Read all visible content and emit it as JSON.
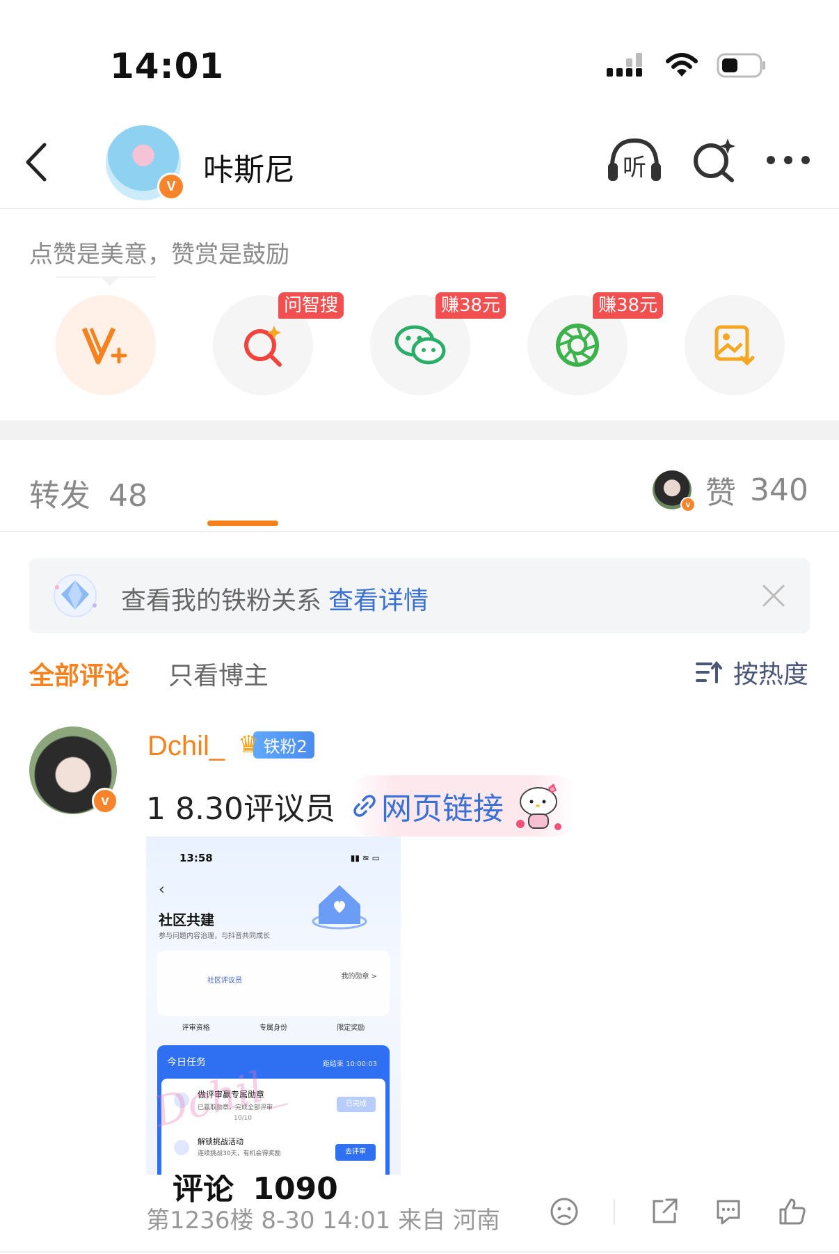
{
  "status_bar": {
    "time": "14:01"
  },
  "header": {
    "username": "咔斯尼",
    "verified_badge": "V"
  },
  "reward": {
    "tip": "点赞是美意，赞赏是鼓励",
    "actions": [
      {
        "icon": "v-plus-icon",
        "tag": ""
      },
      {
        "icon": "search-ai-icon",
        "tag": "问智搜"
      },
      {
        "icon": "wechat-icon",
        "tag": "赚38元"
      },
      {
        "icon": "moments-icon",
        "tag": "赚38元"
      },
      {
        "icon": "save-image-icon",
        "tag": ""
      }
    ]
  },
  "tabs": {
    "repost_label": "转发",
    "repost_count": "48",
    "comment_label": "评论",
    "comment_count": "1090",
    "like_label": "赞",
    "like_count": "340"
  },
  "fan_banner": {
    "text": "查看我的铁粉关系",
    "link": "查看详情"
  },
  "filter": {
    "all": "全部评论",
    "host_only": "只看博主",
    "sort": "按热度"
  },
  "comment": {
    "author": "Dchil_",
    "fan_level": "铁粉2",
    "text": "1 8.30评议员",
    "link_label": "网页链接",
    "image": {
      "time": "13:58",
      "title": "社区共建",
      "subtitle": "参与问题内容治理，与抖音共同成长",
      "role": "社区评议员",
      "my_medal": "我的勋章 >",
      "perks": [
        "评审资格",
        "专属身份",
        "限定奖励"
      ],
      "today_tasks": "今日任务",
      "countdown": "距结束 10:00:03",
      "task1_title": "做评审赢专属勋章",
      "task1_desc": "已赢取勋章，完成全部评审",
      "task1_progress": "10/10",
      "task1_button": "已完成",
      "task2_title": "解锁挑战活动",
      "task2_desc": "连续挑战30天，有机会得奖励",
      "task2_button": "去评审",
      "watermark": "Dchil_"
    },
    "meta": "第1236楼 8-30 14:01 来自 河南"
  },
  "colors": {
    "accent": "#f6821f",
    "link": "#3a6fd4",
    "badge": "#f25050"
  }
}
